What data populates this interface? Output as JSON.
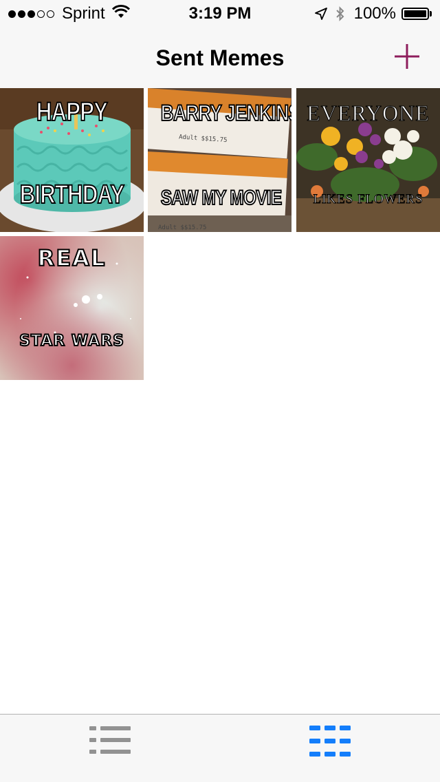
{
  "status_bar": {
    "carrier": "Sprint",
    "time": "3:19 PM",
    "battery_percent": "100%"
  },
  "nav": {
    "title": "Sent Memes",
    "add_icon": "plus-icon"
  },
  "memes": [
    {
      "top": "HAPPY",
      "bottom": "BIRTHDAY",
      "image": "birthday-cake"
    },
    {
      "top": "BARRY JENKINS",
      "bottom": "SAW MY MOVIE",
      "image": "movie-tickets"
    },
    {
      "top": "EVERYONE",
      "bottom": "LIKES FLOWERS",
      "image": "flower-bouquet"
    },
    {
      "top": "REAL",
      "bottom": "STAR WARS",
      "image": "space-nebula"
    }
  ],
  "tabs": [
    {
      "icon": "list-icon",
      "selected": false
    },
    {
      "icon": "grid-icon",
      "selected": true
    }
  ],
  "colors": {
    "accent": "#8e1d5c",
    "tab_selected": "#147efb",
    "tab_unselected": "#929292"
  }
}
